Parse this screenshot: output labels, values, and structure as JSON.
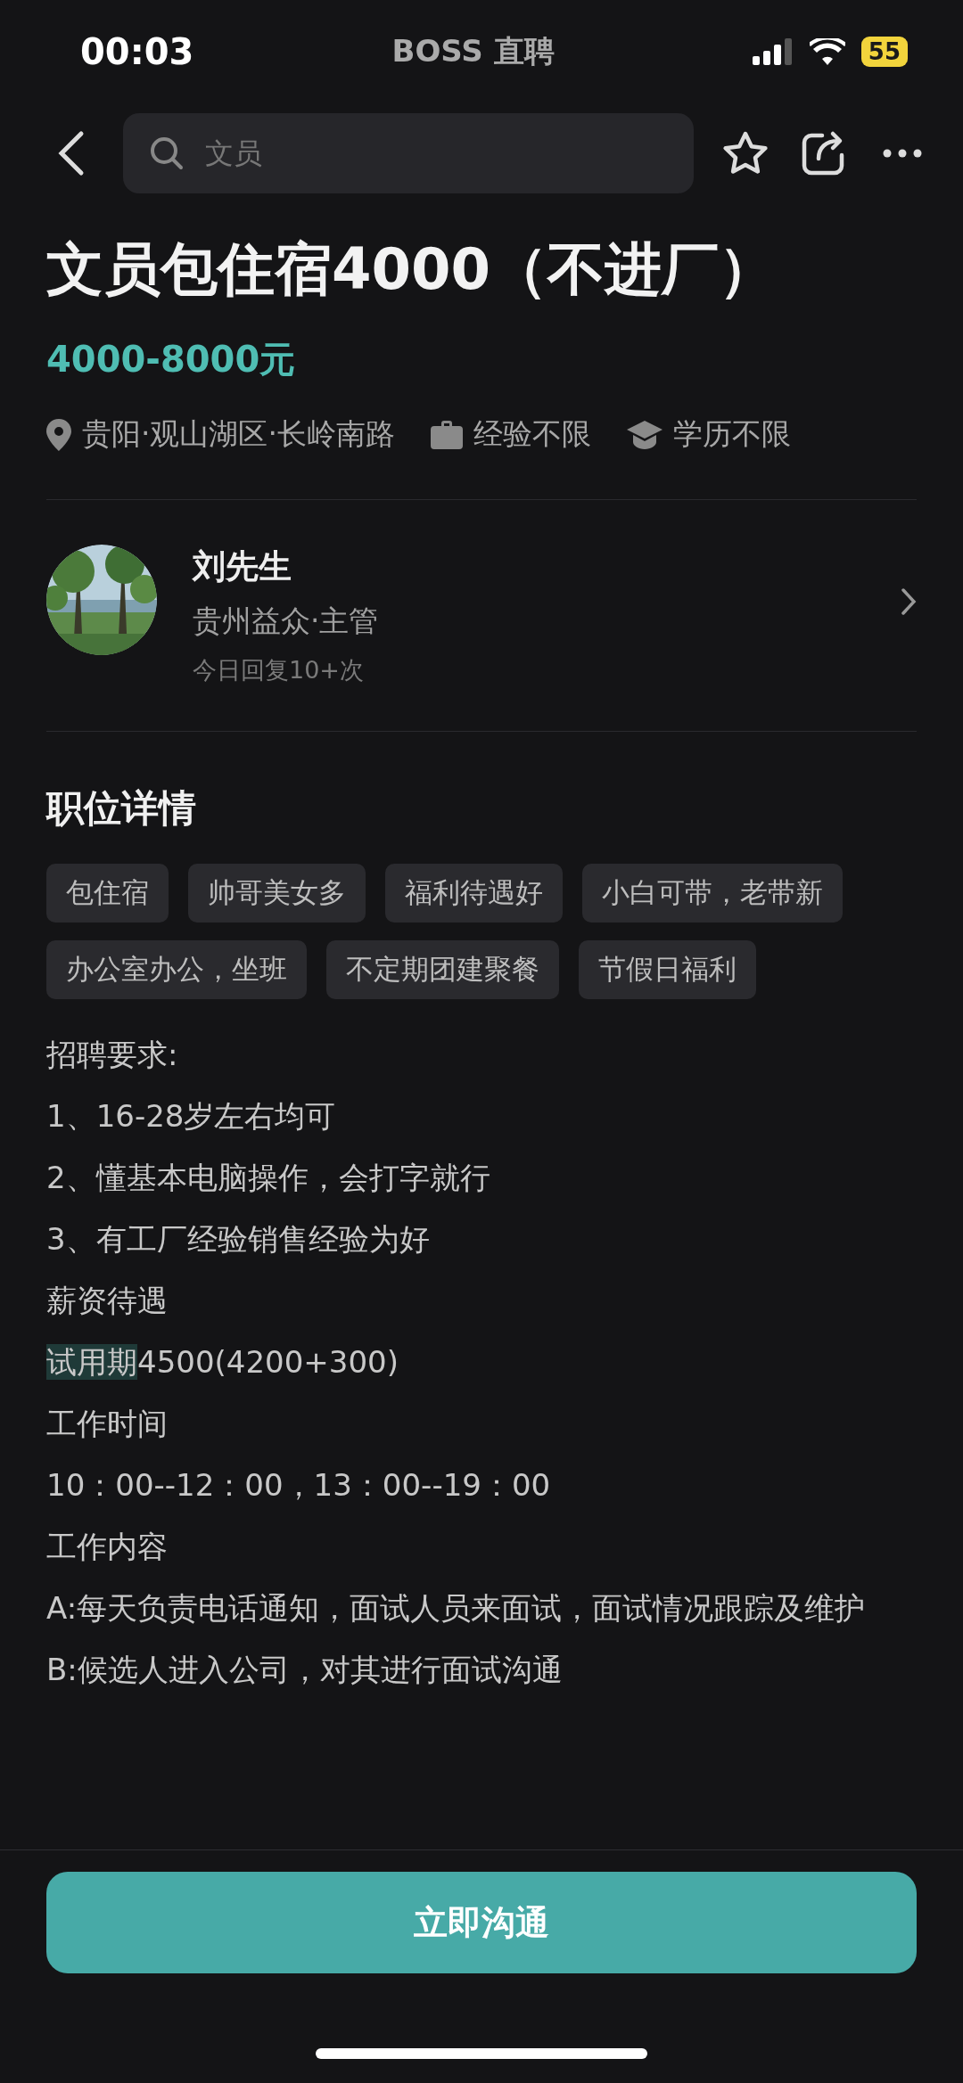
{
  "status_bar": {
    "time": "00:03",
    "app_name": "BOSS 直聘",
    "battery": "55"
  },
  "nav": {
    "search_placeholder": "文员"
  },
  "job": {
    "title": "文员包住宿4000（不进厂）",
    "salary": "4000-8000元",
    "meta": [
      {
        "kind": "location",
        "text": "贵阳·观山湖区·长岭南路"
      },
      {
        "kind": "experience",
        "text": "经验不限"
      },
      {
        "kind": "education",
        "text": "学历不限"
      }
    ]
  },
  "recruiter": {
    "name": "刘先生",
    "company": "贵州益众·主管",
    "activity": "今日回复10+次"
  },
  "details": {
    "heading": "职位详情",
    "tags": [
      "包住宿",
      "帅哥美女多",
      "福利待遇好",
      "小白可带，老带新",
      "办公室办公，坐班",
      "不定期团建聚餐",
      "节假日福利"
    ],
    "lines": [
      {
        "text": "招聘要求:"
      },
      {
        "text": "1、16-28岁左右均可"
      },
      {
        "text": "2、懂基本电脑操作，会打字就行"
      },
      {
        "text": "3、有工厂经验销售经验为好"
      },
      {
        "text": "薪资待遇"
      },
      {
        "highlight": "试用期",
        "text": "4500(4200+300)"
      },
      {
        "text": "工作时间"
      },
      {
        "text": "10：00--12：00，13：00--19：00"
      },
      {
        "text": "工作内容"
      },
      {
        "text": "A:每天负责电话通知，面试人员来面试，面试情况跟踪及维护"
      },
      {
        "text": "B:候选人进入公司，对其进行面试沟通"
      }
    ]
  },
  "footer": {
    "button": "立即沟通"
  }
}
